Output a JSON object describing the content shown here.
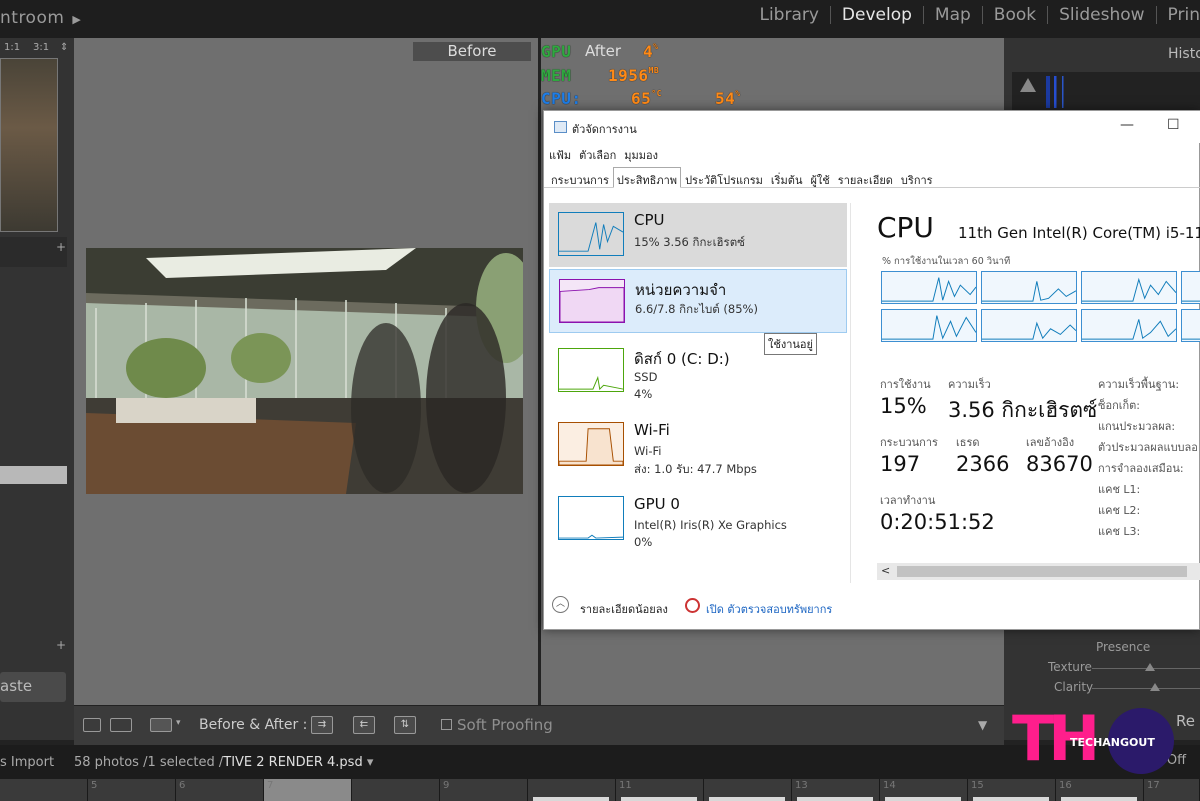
{
  "lr": {
    "brand": "ntroom",
    "modules": [
      "Library",
      "Develop",
      "Map",
      "Book",
      "Slideshow",
      "Prin"
    ],
    "active_module": "Develop",
    "zoom": [
      "1:1",
      "3:1"
    ],
    "before_label": "Before",
    "after_label": "After",
    "histogram_label": "Histo",
    "presence": "Presence",
    "texture": "Texture",
    "clarity": "Clarity",
    "paste": "aste",
    "right_btn": "Re",
    "toolbar": {
      "before_after": "Before & After :",
      "soft_proofing": "Soft Proofing"
    },
    "filmstrip": {
      "import": "s Import",
      "info_count": "58 photos /1 selected /",
      "info_file": "TIVE 2 RENDER 4.psd",
      "info_arrow": "▾",
      "off": "s Off",
      "numbers": [
        "",
        "5",
        "6",
        "7",
        "",
        "9",
        "",
        "11",
        "",
        "13",
        "14",
        "15",
        "16",
        "17"
      ]
    }
  },
  "overlay": {
    "gpu_label": "GPU",
    "gpu_val": "4",
    "gpu_unit": "%",
    "mem_label": "MEM",
    "mem_val": "1956",
    "mem_unit": "MB",
    "cpu_label": "CPU:",
    "cpu_temp": "65",
    "cpu_temp_unit": "°C",
    "cpu_load": "54",
    "cpu_load_unit": "%"
  },
  "tm": {
    "title": "ตัวจัดการงาน",
    "win_min": "—",
    "win_max": "☐",
    "menu": [
      "แฟ้ม",
      "ตัวเลือก",
      "มุมมอง"
    ],
    "tabs": [
      "กระบวนการ",
      "ประสิทธิภาพ",
      "ประวัติโปรแกรม",
      "เริ่มต้น",
      "ผู้ใช้",
      "รายละเอียด",
      "บริการ"
    ],
    "active_tab": "ประสิทธิภาพ",
    "resources": [
      {
        "name": "CPU",
        "s1": "15%  3.56 กิกะเฮิรตซ์",
        "s2": ""
      },
      {
        "name": "หน่วยความจำ",
        "s1": "6.6/7.8 กิกะไบต์ (85%)",
        "s2": ""
      },
      {
        "name": "ดิสก์ 0 (C: D:)",
        "s1": "SSD",
        "s2": "4%"
      },
      {
        "name": "Wi-Fi",
        "s1": "Wi-Fi",
        "s2": "ส่ง: 1.0  รับ: 47.7 Mbps"
      },
      {
        "name": "GPU 0",
        "s1": "Intel(R) Iris(R) Xe Graphics",
        "s2": "0%"
      }
    ],
    "tooltip": "ใช้งานอยู่",
    "detail": {
      "title": "CPU",
      "model": "11th Gen Intel(R) Core(TM) i5-11",
      "sub": "% การใช้งานในเวลา 60 วินาที",
      "usage_label": "การใช้งาน",
      "usage": "15%",
      "speed_label": "ความเร็ว",
      "speed": "3.56 กิกะเฮิรตซ์",
      "proc_label": "กระบวนการ",
      "proc": "197",
      "threads_label": "เธรด",
      "threads": "2366",
      "handles_label": "เลขอ้างอิง",
      "handles": "83670",
      "uptime_label": "เวลาทำงาน",
      "uptime": "0:20:51:52",
      "right_labels": [
        "ความเร็วพื้นฐาน:",
        "ซ็อกเก็ต:",
        "แกนประมวลผล:",
        "ตัวประมวลผลแบบลอ",
        "การจำลองเสมือน:",
        "แคช L1:",
        "แคช L2:",
        "แคช L3:"
      ]
    },
    "foot_less": "รายละเอียดน้อยลง",
    "foot_open": "เปิด ตัวตรวจสอบทรัพยากร"
  },
  "logo": {
    "th": "TH",
    "text": "TECHANGOUT"
  },
  "colors": {
    "cpu_graph": "#117dbb",
    "mem_graph": "#8b12ae",
    "disk_graph": "#4da60c",
    "wifi_graph": "#a74f01",
    "gpu_graph": "#117dbb",
    "overlay_green": "#2fa83f",
    "overlay_blue": "#1e7ee8",
    "overlay_orange": "#ff8a17"
  }
}
